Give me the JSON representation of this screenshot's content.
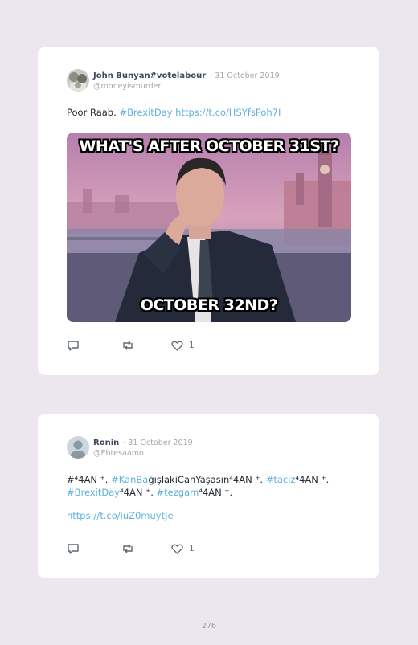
{
  "tweets": [
    {
      "name": "John Bunyan#votelabour",
      "date": "· 31 October 2019",
      "handle": "@moneyismurder",
      "text_plain": "Poor Raab. ",
      "hashtag": "#BrexitDay",
      "link": " https://t.co/HSYfsPoh7I",
      "image": {
        "caption_top": "WHAT'S AFTER OCTOBER 31ST?",
        "caption_bottom": "OCTOBER 32ND?"
      },
      "likes": "1"
    },
    {
      "name": "Ronin",
      "date": "· 31 October 2019",
      "handle": "@Ebtesaamo",
      "seg1": "#",
      "seg2": "⁴4AN ⁺. ",
      "seg3": "#KanBa",
      "seg4": "ğışlakiCanYaşasın⁴4AN ⁺. ",
      "seg5": "#taciz",
      "seg6": "⁴4AN ⁺.",
      "seg7": "#BrexitDay",
      "seg8": "⁴4AN ⁺. ",
      "seg9": "#tezgam",
      "seg10": "⁴4AN ⁺.",
      "link": "https://t.co/iuZ0muytJe",
      "likes": "1"
    }
  ],
  "page_number": "276",
  "icons": [
    "reply-icon",
    "retweet-icon",
    "heart-icon"
  ],
  "colors": {
    "background": "#ece6ee",
    "card": "#ffffff",
    "link": "#5fb1e0",
    "name": "#3d4a5c",
    "muted": "#a3a9b2"
  }
}
